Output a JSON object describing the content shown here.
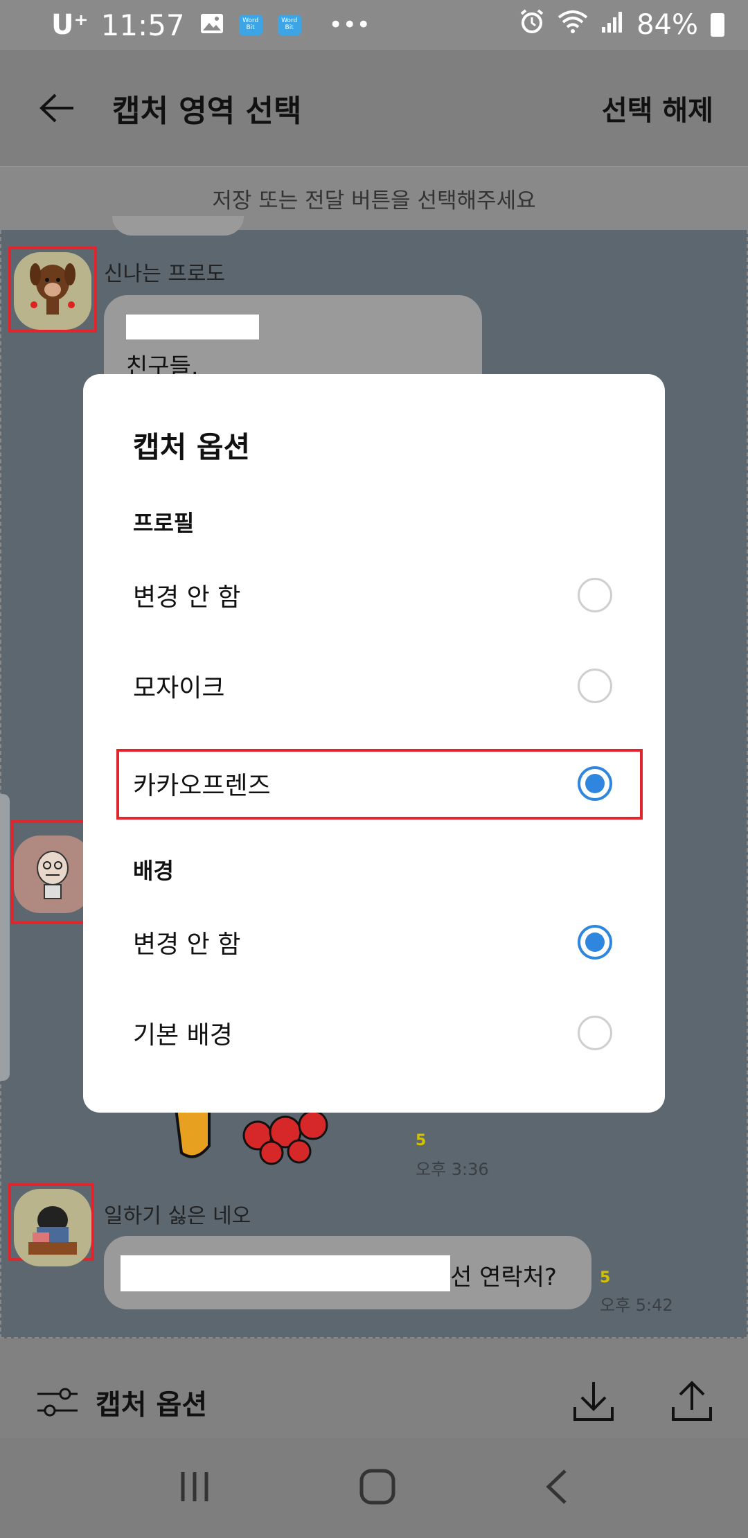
{
  "status_bar": {
    "carrier": "U⁺",
    "time": "11:57",
    "battery": "84%",
    "icons": [
      "gallery-icon",
      "wordbit-icon",
      "wordbit-icon",
      "more-notifications-icon",
      "alarm-icon",
      "wifi-icon",
      "signal-icon",
      "battery-icon"
    ],
    "wordbit_label": "Word Bit"
  },
  "app_bar": {
    "title": "캡처 영역 선택",
    "deselect": "선택 해제"
  },
  "hint": "저장 또는 전달 버튼을 선택해주세요",
  "chat": {
    "messages": [
      {
        "sender": "신나는 프로도",
        "text_line2": "친구들."
      },
      {
        "sender": "일하기 싫은 네오",
        "text_suffix": "선 연락처?",
        "count": "5",
        "time": "오후 5:42"
      }
    ],
    "mid_count": "5",
    "mid_time": "오후 3:36"
  },
  "dialog": {
    "title": "캡처 옵션",
    "profile_section": "프로필",
    "profile_options": [
      {
        "label": "변경 안 함",
        "selected": false
      },
      {
        "label": "모자이크",
        "selected": false
      },
      {
        "label": "카카오프렌즈",
        "selected": true
      }
    ],
    "background_section": "배경",
    "background_options": [
      {
        "label": "변경 안 함",
        "selected": true
      },
      {
        "label": "기본 배경",
        "selected": false
      }
    ],
    "accent_color": "#2e86de",
    "highlight_color": "#e0262c"
  },
  "toolbar": {
    "options_label": "캡처 옵션"
  }
}
